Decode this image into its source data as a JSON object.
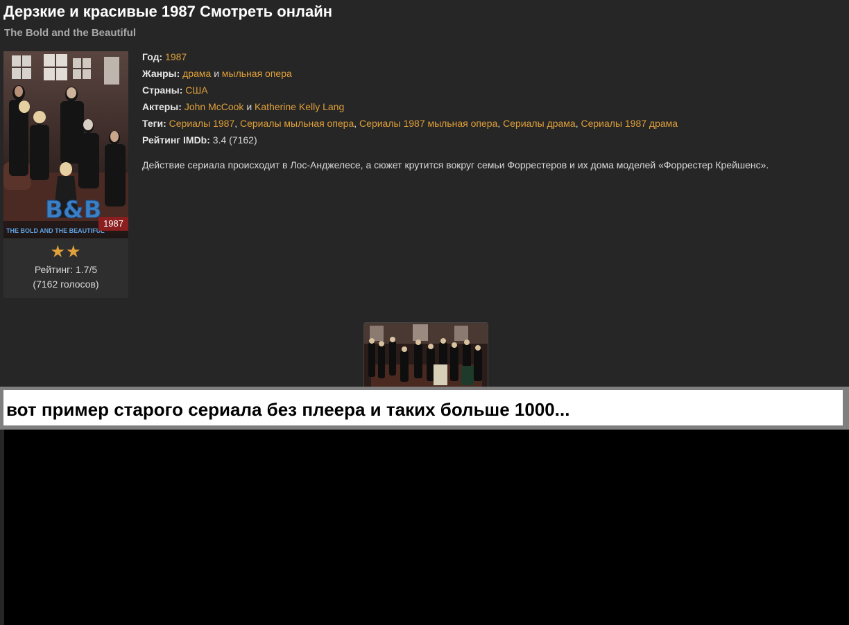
{
  "title": "Дерзкие и красивые 1987 Смотреть онлайн",
  "original_title": "The Bold and the Beautiful",
  "poster": {
    "year_badge": "1987",
    "logo_text": "B&B",
    "caption": "THE BOLD AND THE BEAUTIFUL",
    "stars": "★★",
    "rating_text": "Рейтинг: 1.7/5",
    "votes_text": "(7162 голосов)"
  },
  "info": {
    "year_label": "Год:",
    "year_value": "1987",
    "genres_label": "Жанры:",
    "genres": [
      "драма",
      "мыльная опера"
    ],
    "and_word": "и",
    "countries_label": "Страны:",
    "country": "США",
    "actors_label": "Актеры:",
    "actors": [
      "John McCook",
      "Katherine Kelly Lang"
    ],
    "tags_label": "Теги:",
    "tags": [
      "Сериалы 1987",
      "Сериалы мыльная опера",
      "Сериалы 1987 мыльная опера",
      "Сериалы драма",
      "Сериалы 1987 драма"
    ],
    "separator": ", ",
    "imdb_label": "Рейтинг IMDb:",
    "imdb_value": "3.4 (7162)"
  },
  "description": "Действие сериала происходит в Лос-Анджелесе, а сюжет крутится вокруг семьи Форрестеров и их дома моделей «Форрестер Крейшенс».",
  "overlay_text": "вот пример старого сериала без плеера и таких больше 1000...",
  "colors": {
    "background": "#262626",
    "link": "#e0a03a",
    "badge": "#8b1f1f",
    "overlay_border": "#7f7f7f"
  }
}
